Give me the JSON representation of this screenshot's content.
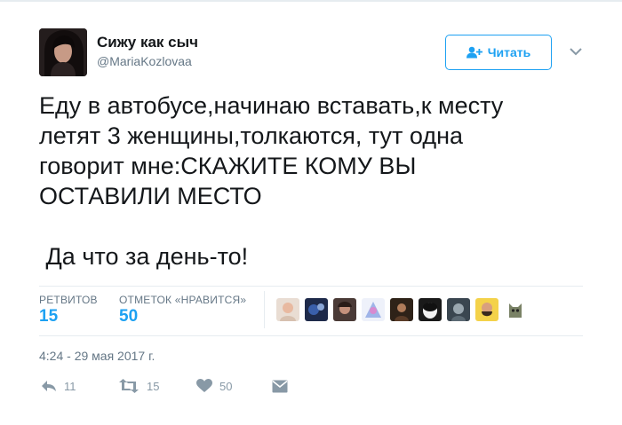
{
  "author": {
    "name": "Сижу как сыч",
    "handle": "@MariaKozlovaa"
  },
  "follow_button": {
    "label": "Читать",
    "icon": "user-plus-icon"
  },
  "menu_caret": {
    "icon": "chevron-down-icon"
  },
  "tweet": {
    "text": "Еду в автобусе,начинаю вставать,к месту\nлетят 3 женщины,толкаются, тут одна\nговорит мне:СКАЖИТЕ КОМУ ВЫ\nОСТАВИЛИ МЕСТО\n\n Да что за день-то!"
  },
  "stats": {
    "retweets_label": "РЕТВИТОВ",
    "retweets_count": "15",
    "likes_label": "ОТМЕТОК «НРАВИТСЯ»",
    "likes_count": "50"
  },
  "likers_count": 9,
  "timestamp": "4:24 - 29 мая 2017 г.",
  "actions": {
    "reply_count": "11",
    "retweet_count": "15",
    "like_count": "50"
  },
  "colors": {
    "accent": "#1da1f2",
    "muted": "#657786",
    "action": "#8899a6"
  }
}
